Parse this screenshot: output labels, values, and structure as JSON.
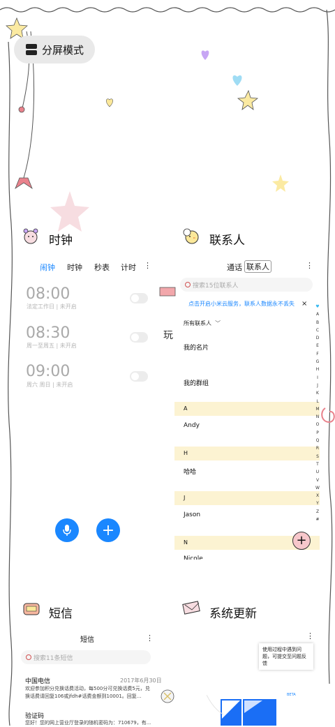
{
  "split_screen": {
    "label": "分屏模式",
    "icon": "split-screen-icon"
  },
  "clock": {
    "title": "时钟",
    "icon": "alarm-clock-sticker-icon",
    "tabs": [
      {
        "label": "闹钟",
        "active": true
      },
      {
        "label": "时钟"
      },
      {
        "label": "秒表"
      },
      {
        "label": "计时"
      }
    ],
    "more_label": "⋮",
    "alarms": [
      {
        "time": "08:00",
        "sub": "法定工作日 | 未开启",
        "enabled": false
      },
      {
        "time": "08:30",
        "sub": "周一至周五 | 未开启",
        "enabled": false
      },
      {
        "time": "09:00",
        "sub": "周六 周日 | 未开启",
        "enabled": false
      }
    ],
    "mic_icon": "microphone-icon",
    "add_icon": "plus-icon"
  },
  "contacts": {
    "title": "联系人",
    "icon": "chick-sticker-icon",
    "tabs": [
      {
        "label": "通话"
      },
      {
        "label": "联系人",
        "active": true
      }
    ],
    "more_label": "⋮",
    "search_placeholder": "搜索15位联系人",
    "banner": "点击开启小米云服务，联系人数据永不丢失",
    "close_label": "×",
    "filter_label": "所有联系人",
    "my_card": "我的名片",
    "my_groups": "我的群组",
    "sections": [
      {
        "letter": "A",
        "name": "Andy"
      },
      {
        "letter": "H",
        "name": "哈哈"
      },
      {
        "letter": "J",
        "name": "Jason"
      },
      {
        "letter": "N",
        "name": "Nicole"
      }
    ],
    "index_letters": [
      "♥",
      "A",
      "B",
      "C",
      "D",
      "E",
      "F",
      "G",
      "H",
      "I",
      "J",
      "K",
      "L",
      "M",
      "N",
      "O",
      "P",
      "Q",
      "R",
      "S",
      "T",
      "U",
      "V",
      "W",
      "X",
      "Y",
      "Z",
      "#"
    ],
    "add_label": "+"
  },
  "sms": {
    "title": "短信",
    "icon": "sms-sticker-icon",
    "header": "短信",
    "more_label": "⋮",
    "search_placeholder": "搜索11条短信",
    "messages": [
      {
        "sender": "中国电信",
        "date": "2017年6月30日",
        "body": "欢迎参加积分兑换话费活动，每500分可兑换话费5元，兑换话费请回复106或jfdh#话费金额到10001。回复..."
      },
      {
        "sender": "验证码",
        "body": "您好！您的网上营业厅登录的随机密码为：710679，有..."
      }
    ]
  },
  "updater": {
    "title": "系统更新",
    "icon": "envelope-sticker-icon",
    "more_label": "⋮",
    "tooltip": "使用过程中遇到问题，可提交至问题反馈",
    "badge": "BETA"
  },
  "side_text": "玩",
  "colors": {
    "accent": "#1a87ff",
    "section_bg": "#fcf3d2",
    "add_button": "#f7c7cb"
  }
}
